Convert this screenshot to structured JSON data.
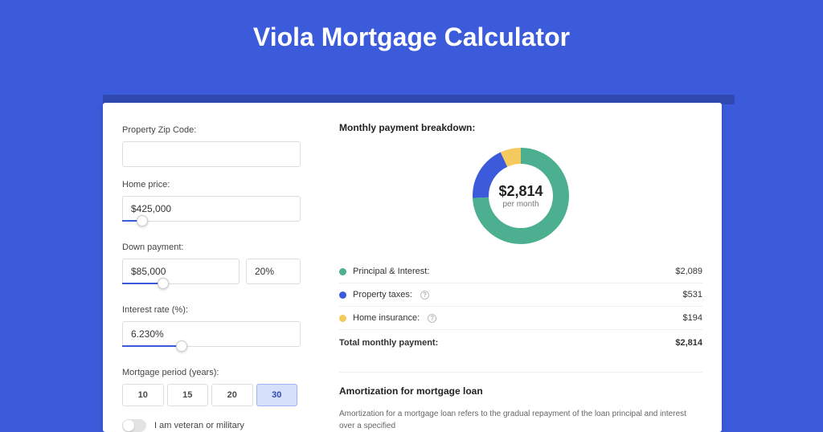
{
  "title": "Viola Mortgage Calculator",
  "form": {
    "zip_label": "Property Zip Code:",
    "zip_value": "",
    "home_price_label": "Home price:",
    "home_price_value": "$425,000",
    "down_payment_label": "Down payment:",
    "down_payment_value": "$85,000",
    "down_payment_pct": "20%",
    "interest_label": "Interest rate (%):",
    "interest_value": "6.230%",
    "period_label": "Mortgage period (years):",
    "periods": [
      "10",
      "15",
      "20",
      "30"
    ],
    "period_selected": "30",
    "veteran_label": "I am veteran or military"
  },
  "breakdown": {
    "title": "Monthly payment breakdown:",
    "center_amount": "$2,814",
    "center_sub": "per month",
    "items": [
      {
        "label": "Principal & Interest:",
        "value": "$2,089",
        "color": "green",
        "info": false
      },
      {
        "label": "Property taxes:",
        "value": "$531",
        "color": "blue",
        "info": true
      },
      {
        "label": "Home insurance:",
        "value": "$194",
        "color": "yellow",
        "info": true
      }
    ],
    "total_label": "Total monthly payment:",
    "total_value": "$2,814"
  },
  "amort": {
    "title": "Amortization for mortgage loan",
    "text": "Amortization for a mortgage loan refers to the gradual repayment of the loan principal and interest over a specified"
  },
  "chart_data": {
    "type": "pie",
    "title": "Monthly payment breakdown",
    "series": [
      {
        "name": "Principal & Interest",
        "value": 2089,
        "color": "#4caf8f"
      },
      {
        "name": "Property taxes",
        "value": 531,
        "color": "#3b5bdb"
      },
      {
        "name": "Home insurance",
        "value": 194,
        "color": "#f4c95d"
      }
    ],
    "total": 2814
  }
}
